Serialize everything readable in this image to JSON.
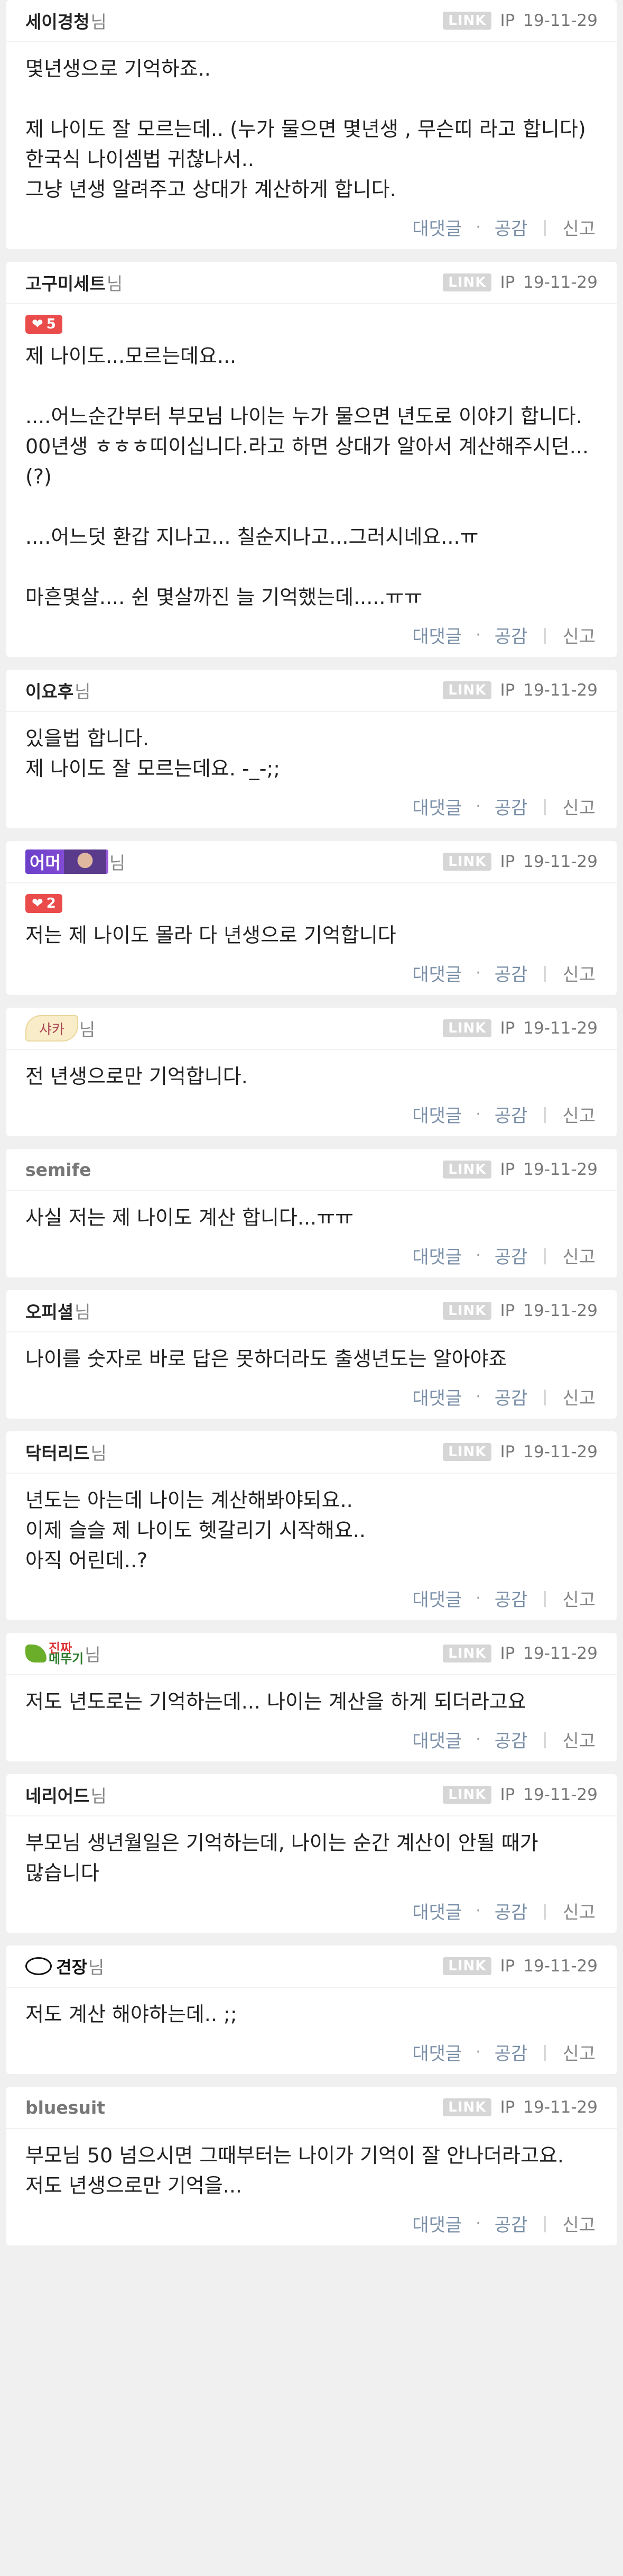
{
  "ui": {
    "link_badge": "LINK",
    "ip_label": "IP",
    "reply_label": "대댓글",
    "like_label": "공감",
    "report_label": "신고",
    "dot": "·",
    "nim": "님",
    "colors": {
      "like_badge": "#ea4b4b",
      "action_text": "#7a8fa8",
      "background": "#f0f0f0"
    }
  },
  "comments": [
    {
      "nickname": "세이경청",
      "date": "19-11-29",
      "likes": null,
      "text": "몇년생으로 기억하죠..\n\n제 나이도 잘 모르는데.. (누가 물으면 몇년생 , 무슨띠 라고 합니다)\n한국식 나이셈법 귀찮나서..\n그냥 년생 알려주고 상대가 계산하게 합니다."
    },
    {
      "nickname": "고구미세트",
      "date": "19-11-29",
      "likes": "5",
      "text": "제 나이도...모르는데요...\n\n....어느순간부터 부모님 나이는 누가 물으면 년도로 이야기 합니다.\n00년생 ㅎㅎㅎ띠이십니다.라고 하면 상대가 알아서 계산해주시던...(?)\n\n....어느덧 환갑 지나고... 칠순지나고...그러시네요...ㅠ\n\n마흔몇살.... 쉰 몇살까진 늘 기억했는데.....ㅠㅠ"
    },
    {
      "nickname": "이요후",
      "date": "19-11-29",
      "likes": null,
      "text": "있을법 합니다.\n제 나이도 잘 모르는데요. -_-;;"
    },
    {
      "nickname": "어머",
      "nickname_style": "purple",
      "date": "19-11-29",
      "likes": "2",
      "text": "저는 제 나이도 몰라 다 년생으로 기억합니다"
    },
    {
      "nickname": "샤카",
      "nickname_style": "shaka",
      "date": "19-11-29",
      "likes": null,
      "text": "전 년생으로만 기억합니다."
    },
    {
      "nickname": "semife",
      "nickname_style": "grey",
      "date": "19-11-29",
      "likes": null,
      "text": "사실 저는 제 나이도 계산 합니다...ㅠㅠ"
    },
    {
      "nickname": "오피셜",
      "date": "19-11-29",
      "likes": null,
      "text": "나이를 숫자로 바로 답은 못하더라도 출생년도는 알아야죠"
    },
    {
      "nickname": "닥터리드",
      "date": "19-11-29",
      "likes": null,
      "text": "년도는 아는데 나이는 계산해봐야되요..\n이제 슬슬 제 나이도 헷갈리기 시작해요..\n아직 어린데..?"
    },
    {
      "nickname": "진짜 메뚜기",
      "nickname_parts": [
        "진짜",
        "메뚜기"
      ],
      "nickname_style": "grass",
      "date": "19-11-29",
      "likes": null,
      "text": "저도 년도로는 기억하는데... 나이는 계산을 하게 되더라고요"
    },
    {
      "nickname": "네리어드",
      "date": "19-11-29",
      "likes": null,
      "text": "부모님 생년월일은 기억하는데, 나이는 순간 계산이 안될 때가 많습니다"
    },
    {
      "nickname": "견장",
      "nickname_style": "gyeonjang",
      "date": "19-11-29",
      "likes": null,
      "text": "저도 계산 해야하는데.. ;;"
    },
    {
      "nickname": "bluesuit",
      "nickname_style": "grey",
      "date": "19-11-29",
      "likes": null,
      "text": "부모님 50 넘으시면 그때부터는 나이가 기억이 잘 안나더라고요. 저도 년생으로만 기억을..."
    }
  ]
}
